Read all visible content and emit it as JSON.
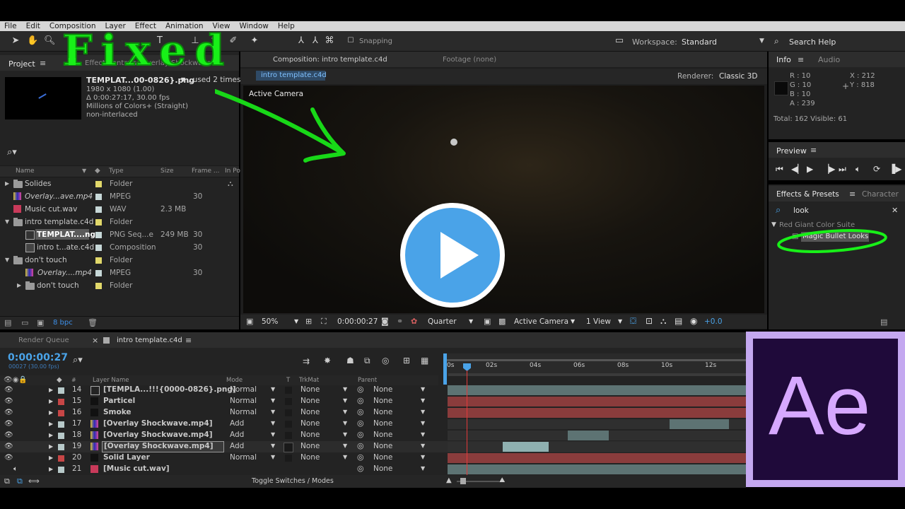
{
  "menu": [
    "File",
    "Edit",
    "Composition",
    "Layer",
    "Effect",
    "Animation",
    "View",
    "Window",
    "Help"
  ],
  "toolbar": {
    "snapping": "Snapping",
    "workspace_label": "Workspace:",
    "workspace_value": "Standard",
    "search_help": "Search Help"
  },
  "overlay_text": "Fixed",
  "project": {
    "tab": "Project",
    "tab2": "Effect Controls: Overlay Shockwave",
    "file_name": "TEMPLAT...00-0826}.png",
    "file_used": ", used 2 times",
    "file_info": [
      "1980 x 1080 (1.00)",
      "Δ 0:00:27:17, 30.00 fps",
      "Millions of Colors+ (Straight)",
      "non-interlaced"
    ],
    "columns": [
      "Name",
      "Type",
      "Size",
      "Frame ...",
      "In Po"
    ],
    "rows": [
      {
        "name": "Solides",
        "type": "Folder",
        "size": "",
        "fr": "",
        "color": "#e1d86a"
      },
      {
        "name": "Overlay...ave.mp4",
        "type": "MPEG",
        "size": "",
        "fr": "30",
        "color": "#c8c8c8"
      },
      {
        "name": "Music cut.wav",
        "type": "WAV",
        "size": "2.3 MB",
        "fr": "",
        "color": "#c8c8c8"
      },
      {
        "name": "intro template.c4d",
        "type": "Folder",
        "size": "",
        "fr": "",
        "color": "#e1d86a"
      },
      {
        "name": "TEMPLAT....ng",
        "type": "PNG Seq...e",
        "size": "249 MB",
        "fr": "30",
        "color": "#c8c8c8"
      },
      {
        "name": "intro t...ate.c4d",
        "type": "Composition",
        "size": "",
        "fr": "30",
        "color": "#c8c8c8"
      },
      {
        "name": "don't touch",
        "type": "Folder",
        "size": "",
        "fr": "",
        "color": "#e1d86a"
      },
      {
        "name": "Overlay....mp4",
        "type": "MPEG",
        "size": "",
        "fr": "30",
        "color": "#c8c8c8"
      },
      {
        "name": "don't touch",
        "type": "Folder",
        "size": "",
        "fr": "",
        "color": "#e1d86a"
      }
    ],
    "bpc": "8 bpc"
  },
  "composition": {
    "tab": "Composition: intro template.c4d",
    "footage": "Footage (none)",
    "subtab": "intro template.c4d",
    "renderer_label": "Renderer:",
    "renderer_value": "Classic 3D",
    "camera_label": "Active Camera",
    "zoom": "50%",
    "timecode": "0:00:00:27",
    "resolution": "Quarter",
    "view_camera": "Active Camera",
    "views": "1 View",
    "offset": "+0.0"
  },
  "info": {
    "tab": "Info",
    "tab2": "Audio",
    "r": "R : 10",
    "g": "G : 10",
    "b": "B : 10",
    "a": "A : 239",
    "x": "X : 212",
    "y": "Y : 818",
    "totals": "Total: 162   Visible: 61"
  },
  "preview": {
    "tab": "Preview"
  },
  "effects": {
    "tab": "Effects & Presets",
    "tab2": "Character",
    "search_value": "look",
    "category": "Red Giant Color Suite",
    "item": "Magic Bullet Looks"
  },
  "timeline": {
    "tab_render": "Render Queue",
    "tab_comp": "intro template.c4d",
    "timecode": "0:00:00:27",
    "subcode": "00027 (30.00 fps)",
    "col_layer": "Layer Name",
    "col_mode": "Mode",
    "col_t": "T",
    "col_trk": "TrkMat",
    "col_parent": "Parent",
    "ruler": [
      "0s",
      "02s",
      "04s",
      "06s",
      "08s",
      "10s",
      "12s"
    ],
    "toggle": "Toggle Switches / Modes",
    "layers": [
      {
        "num": "14",
        "name": "[TEMPLA...!!!{0000-0826}.png]",
        "mode": "Normal",
        "trk": "None",
        "parent": "None",
        "label": "#b7c9c9"
      },
      {
        "num": "15",
        "name": "Particel",
        "mode": "Normal",
        "trk": "None",
        "parent": "None",
        "label": "#c74646"
      },
      {
        "num": "16",
        "name": "Smoke",
        "mode": "Normal",
        "trk": "None",
        "parent": "None",
        "label": "#c74646"
      },
      {
        "num": "17",
        "name": "[Overlay Shockwave.mp4]",
        "mode": "Add",
        "trk": "None",
        "parent": "None",
        "label": "#b7c9c9"
      },
      {
        "num": "18",
        "name": "[Overlay Shockwave.mp4]",
        "mode": "Add",
        "trk": "None",
        "parent": "None",
        "label": "#b7c9c9"
      },
      {
        "num": "19",
        "name": "[Overlay Shockwave.mp4]",
        "mode": "Add",
        "trk": "None",
        "parent": "None",
        "label": "#b7c9c9"
      },
      {
        "num": "20",
        "name": "Solid Layer",
        "mode": "Normal",
        "trk": "None",
        "parent": "None",
        "label": "#c74646"
      },
      {
        "num": "21",
        "name": "[Music cut.wav]",
        "mode": "",
        "trk": "",
        "parent": "None",
        "label": "#b7c9c9"
      }
    ]
  },
  "ae_logo": "Ae",
  "colors": {
    "accent_blue": "#4aa3e8",
    "green_annotation": "#18f018",
    "logo_bg": "#1f0a3a",
    "logo_fg": "#d6a8ff",
    "bar_red": "#8a3c3c",
    "bar_teal": "#5d7373"
  }
}
